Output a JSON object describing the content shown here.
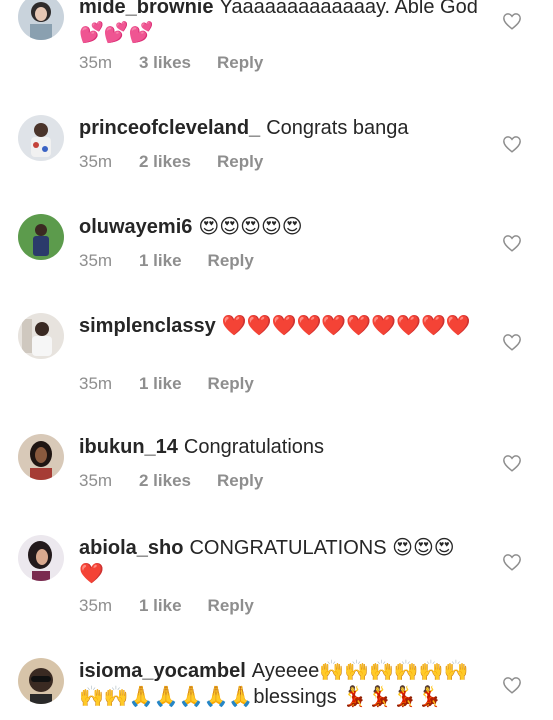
{
  "comments": [
    {
      "username": "mide_brownie",
      "text": "Yaaaaaaaaaaaaay. Able God 💕💕💕",
      "time": "35m",
      "likes": "3 likes",
      "reply": "Reply"
    },
    {
      "username": "princeofcleveland_",
      "text": "Congrats banga",
      "time": "35m",
      "likes": "2 likes",
      "reply": "Reply"
    },
    {
      "username": "oluwayemi6",
      "text": "😍😍😍😍😍",
      "time": "35m",
      "likes": "1 like",
      "reply": "Reply"
    },
    {
      "username": "simplenclassy",
      "text": "❤️❤️❤️❤️❤️❤️❤️❤️❤️❤️",
      "time": "35m",
      "likes": "1 like",
      "reply": "Reply"
    },
    {
      "username": "ibukun_14",
      "text": "Congratulations",
      "time": "35m",
      "likes": "2 likes",
      "reply": "Reply"
    },
    {
      "username": "abiola_sho",
      "text": "CONGRATULATIONS 😍😍😍❤️",
      "time": "35m",
      "likes": "1 like",
      "reply": "Reply"
    },
    {
      "username": "isioma_yocambel",
      "text": "Ayeeee🙌🙌🙌🙌🙌🙌🙌🙌🙏🙏🙏🙏🙏blessings 💃💃💃💃",
      "time": "",
      "likes": "",
      "reply": ""
    }
  ],
  "icons": {
    "like": "heart-outline-icon"
  },
  "colors": {
    "text": "#262626",
    "meta": "#8e8e8e"
  }
}
